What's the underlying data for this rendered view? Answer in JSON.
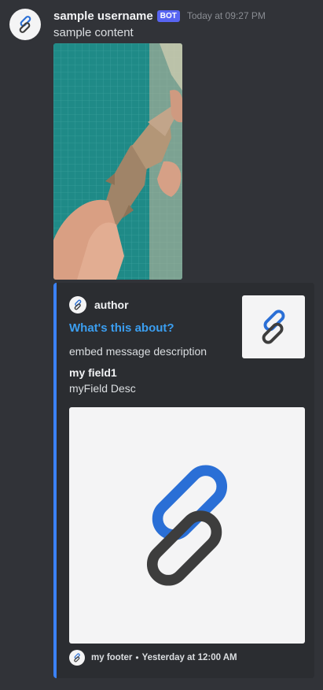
{
  "message": {
    "username": "sample username",
    "bot_tag": "BOT",
    "timestamp": "Today at 09:27 PM",
    "content": "sample content",
    "avatar_icon": "link-icon",
    "attachment_icon": "photo"
  },
  "embed": {
    "accent_color": "#3b82f6",
    "author": {
      "name": "author",
      "icon": "link-icon"
    },
    "title": "What's this about?",
    "description": "embed message description",
    "fields": [
      {
        "name": "my field1",
        "value": "myField Desc"
      }
    ],
    "thumbnail_icon": "link-icon",
    "image_icon": "link-icon",
    "footer": {
      "text": "my footer",
      "separator": "•",
      "timestamp": "Yesterday at 12:00 AM",
      "icon": "link-icon"
    }
  },
  "colors": {
    "background": "#313338",
    "embed_background": "#2b2d31",
    "link_blue": "#3b9ef0",
    "bot_tag": "#5865f2",
    "icon_blue": "#2a6fd6",
    "icon_dark": "#3d3d3d"
  }
}
